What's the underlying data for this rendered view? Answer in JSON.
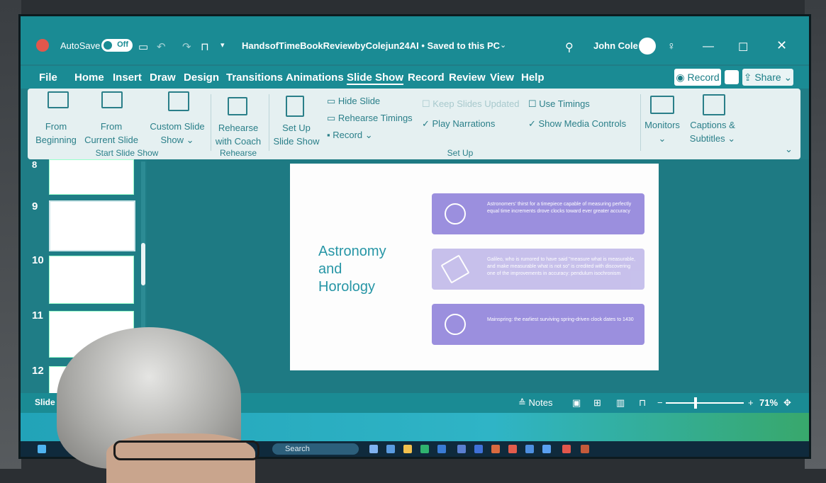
{
  "window": {
    "autosave_label": "AutoSave",
    "autosave_state": "Off",
    "title": "HandsofTimeBookReviewbyColejun24AI • Saved to this PC",
    "user": "John Cole"
  },
  "menu": {
    "items": [
      "File",
      "Home",
      "Insert",
      "Draw",
      "Design",
      "Transitions",
      "Animations",
      "Slide Show",
      "Record",
      "Review",
      "View",
      "Help"
    ],
    "active": "Slide Show",
    "record_button": "Record",
    "share_button": "Share"
  },
  "ribbon": {
    "from_beginning": [
      "From",
      "Beginning"
    ],
    "from_current": [
      "From",
      "Current Slide"
    ],
    "custom_show": [
      "Custom Slide",
      "Show"
    ],
    "group_start": "Start Slide Show",
    "rehearse_coach": [
      "Rehearse",
      "with Coach"
    ],
    "group_rehearse": "Rehearse",
    "setup_show": [
      "Set Up",
      "Slide Show"
    ],
    "hide_slide": "Hide Slide",
    "rehearse_timings": "Rehearse Timings",
    "record": "Record",
    "keep_updated": "Keep Slides Updated",
    "play_narrations": "Play Narrations",
    "use_timings": "Use Timings",
    "show_media_controls": "Show Media Controls",
    "group_setup": "Set Up",
    "monitors": "Monitors",
    "captions": [
      "Captions &",
      "Subtitles"
    ]
  },
  "thumbnails": {
    "numbers": [
      "8",
      "9",
      "10",
      "11",
      "12"
    ],
    "selected": "9"
  },
  "slide": {
    "title": [
      "Astronomy",
      "and",
      "Horology"
    ],
    "cards": [
      {
        "icon": "stopwatch-icon",
        "text": "Astronomers' thirst for a timepiece capable of measuring perfectly equal time increments drove clocks toward ever greater accuracy"
      },
      {
        "icon": "telescope-icon",
        "text": "Galileo, who is rumored to have said \"measure what is measurable, and make measurable what is not so\" is credited with discovering one of the improvements in accuracy: pendulum isochronism"
      },
      {
        "icon": "clock-icon",
        "text": "Mainspring: the earliest surviving spring-driven clock dates to 1430"
      }
    ]
  },
  "status": {
    "slide_indicator": "Slide 9 of",
    "notes": "Notes",
    "zoom": "71%"
  },
  "taskbar": {
    "search_placeholder": "Search"
  }
}
